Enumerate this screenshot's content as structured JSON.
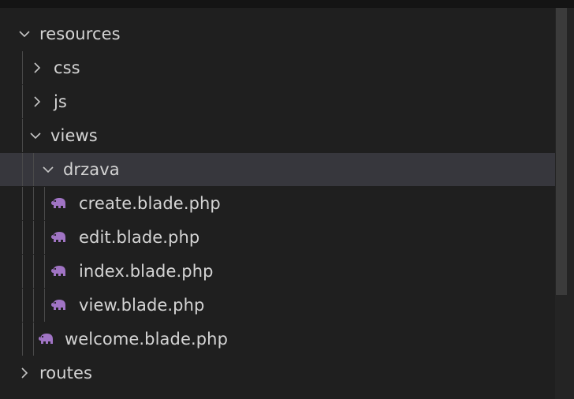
{
  "explorer": {
    "items": [
      {
        "label": "resources",
        "kind": "folder",
        "expanded": true,
        "depth": 0
      },
      {
        "label": "css",
        "kind": "folder",
        "expanded": false,
        "depth": 1
      },
      {
        "label": "js",
        "kind": "folder",
        "expanded": false,
        "depth": 1
      },
      {
        "label": "views",
        "kind": "folder",
        "expanded": true,
        "depth": 1
      },
      {
        "label": "drzava",
        "kind": "folder",
        "expanded": true,
        "depth": 2,
        "selected": true
      },
      {
        "label": "create.blade.php",
        "kind": "file",
        "depth": 3
      },
      {
        "label": "edit.blade.php",
        "kind": "file",
        "depth": 3
      },
      {
        "label": "index.blade.php",
        "kind": "file",
        "depth": 3
      },
      {
        "label": "view.blade.php",
        "kind": "file",
        "depth": 3
      },
      {
        "label": "welcome.blade.php",
        "kind": "file",
        "depth": 2
      },
      {
        "label": "routes",
        "kind": "folder",
        "expanded": false,
        "depth": 0
      }
    ]
  },
  "icons": {
    "chevron_expanded": "chevron-down-icon",
    "chevron_collapsed": "chevron-right-icon",
    "file": "php-elephant-icon"
  },
  "colors": {
    "background": "#1f1f1f",
    "selected_row": "#37373d",
    "text": "#d4d4d4",
    "php_icon": "#a074c4"
  }
}
